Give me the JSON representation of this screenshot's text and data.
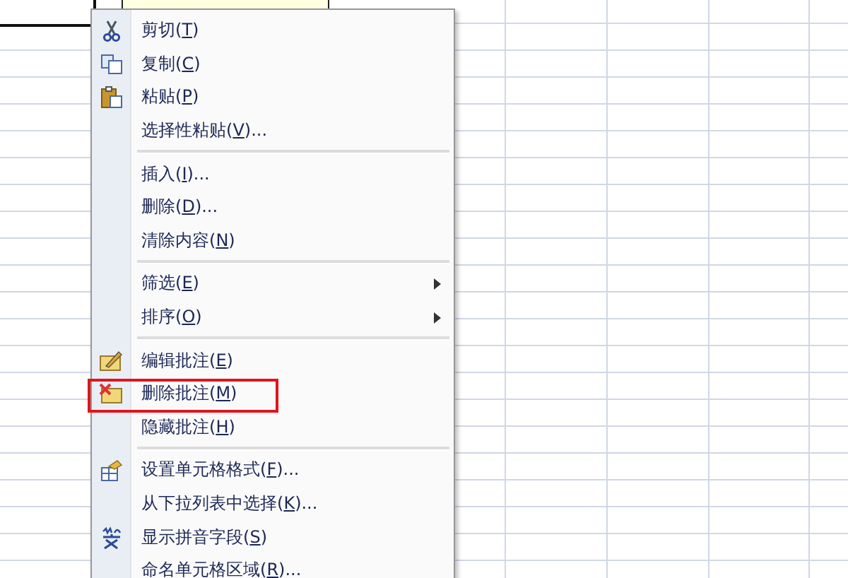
{
  "comment_box": {
    "visible": true
  },
  "context_menu": {
    "items": [
      {
        "label": "剪切(",
        "mnemonic": "T",
        "label_end": ")",
        "kind": "cut",
        "submenu": false,
        "highlighted": false
      },
      {
        "label": "复制(",
        "mnemonic": "C",
        "label_end": ")",
        "kind": "copy",
        "submenu": false,
        "highlighted": false
      },
      {
        "label": "粘贴(",
        "mnemonic": "P",
        "label_end": ")",
        "kind": "paste",
        "submenu": false,
        "highlighted": false
      },
      {
        "label": "选择性粘贴(",
        "mnemonic": "V",
        "label_end": ")...",
        "kind": "plain",
        "submenu": false,
        "highlighted": false
      },
      {
        "kind": "separator"
      },
      {
        "label": "插入(",
        "mnemonic": "I",
        "label_end": ")...",
        "kind": "plain",
        "submenu": false,
        "highlighted": false
      },
      {
        "label": "删除(",
        "mnemonic": "D",
        "label_end": ")...",
        "kind": "plain",
        "submenu": false,
        "highlighted": false
      },
      {
        "label": "清除内容(",
        "mnemonic": "N",
        "label_end": ")",
        "kind": "plain",
        "submenu": false,
        "highlighted": false
      },
      {
        "kind": "separator"
      },
      {
        "label": "筛选(",
        "mnemonic": "E",
        "label_end": ")",
        "kind": "plain",
        "submenu": true,
        "highlighted": false
      },
      {
        "label": "排序(",
        "mnemonic": "O",
        "label_end": ")",
        "kind": "plain",
        "submenu": true,
        "highlighted": false
      },
      {
        "kind": "separator"
      },
      {
        "label": "编辑批注(",
        "mnemonic": "E",
        "label_end": ")",
        "kind": "edit-comment",
        "submenu": false,
        "highlighted": false
      },
      {
        "label": "删除批注(",
        "mnemonic": "M",
        "label_end": ")",
        "kind": "delete-comment",
        "submenu": false,
        "highlighted": true
      },
      {
        "label": "隐藏批注(",
        "mnemonic": "H",
        "label_end": ")",
        "kind": "plain",
        "submenu": false,
        "highlighted": false
      },
      {
        "kind": "separator"
      },
      {
        "label": "设置单元格格式(",
        "mnemonic": "F",
        "label_end": ")...",
        "kind": "format",
        "submenu": false,
        "highlighted": false
      },
      {
        "label": "从下拉列表中选择(",
        "mnemonic": "K",
        "label_end": ")...",
        "kind": "plain",
        "submenu": false,
        "highlighted": false
      },
      {
        "label": "显示拼音字段(",
        "mnemonic": "S",
        "label_end": ")",
        "kind": "phonetic",
        "submenu": false,
        "highlighted": false
      },
      {
        "label": "命名单元格区域(",
        "mnemonic": "R",
        "label_end": ")...",
        "kind": "plain",
        "submenu": false,
        "highlighted": false
      }
    ]
  }
}
